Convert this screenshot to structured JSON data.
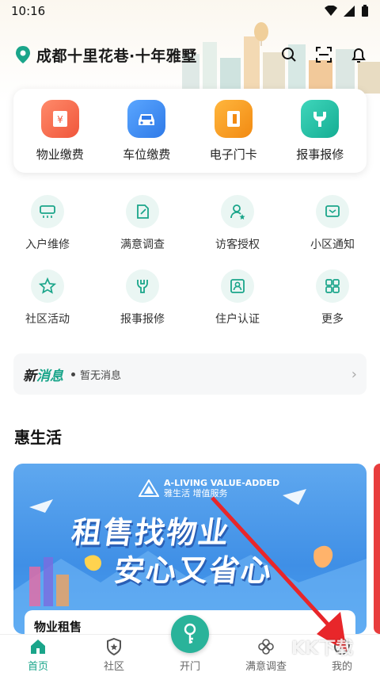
{
  "status_bar": {
    "time": "10:16"
  },
  "header": {
    "community_name": "成都十里花巷·十年雅墅",
    "actions": [
      "search-icon",
      "scan-icon",
      "bell-icon"
    ]
  },
  "primary_services": [
    {
      "label": "物业缴费",
      "icon": "bill-icon",
      "color": "#f26d4f"
    },
    {
      "label": "车位缴费",
      "icon": "car-icon",
      "color": "#3d8bf2"
    },
    {
      "label": "电子门卡",
      "icon": "door-card-icon",
      "color": "#f59a21"
    },
    {
      "label": "报事报修",
      "icon": "wrench-icon",
      "color": "#1fc0a5"
    }
  ],
  "secondary_services": [
    {
      "label": "入户维修",
      "icon": "air-conditioner-icon"
    },
    {
      "label": "满意调查",
      "icon": "survey-icon"
    },
    {
      "label": "访客授权",
      "icon": "visitor-icon"
    },
    {
      "label": "小区通知",
      "icon": "notice-icon"
    },
    {
      "label": "社区活动",
      "icon": "star-icon"
    },
    {
      "label": "报事报修",
      "icon": "wrench-icon"
    },
    {
      "label": "住户认证",
      "icon": "id-card-icon"
    },
    {
      "label": "更多",
      "icon": "grid-icon"
    }
  ],
  "news": {
    "tag_prefix": "新",
    "tag_suffix": "消息",
    "text": "暂无消息"
  },
  "section": {
    "title": "惠生活"
  },
  "banner": {
    "brand_en": "A-LIVING VALUE-ADDED",
    "brand_cn": "雅生活 增值服务",
    "headline_1": "租售找物业",
    "headline_2": "安心又省心",
    "caption": "物业租售"
  },
  "bottom_nav": [
    {
      "label": "首页",
      "icon": "home-icon",
      "active": true
    },
    {
      "label": "社区",
      "icon": "community-shield-icon",
      "active": false
    },
    {
      "label": "开门",
      "icon": "key-icon",
      "active": false
    },
    {
      "label": "满意调查",
      "icon": "flower-icon",
      "active": false
    },
    {
      "label": "我的",
      "icon": "profile-icon",
      "active": false
    }
  ],
  "watermark": "KK下载",
  "colors": {
    "accent": "#1aa58a",
    "banner_blue": "#4a97ec",
    "arrow_red": "#e8262a"
  }
}
